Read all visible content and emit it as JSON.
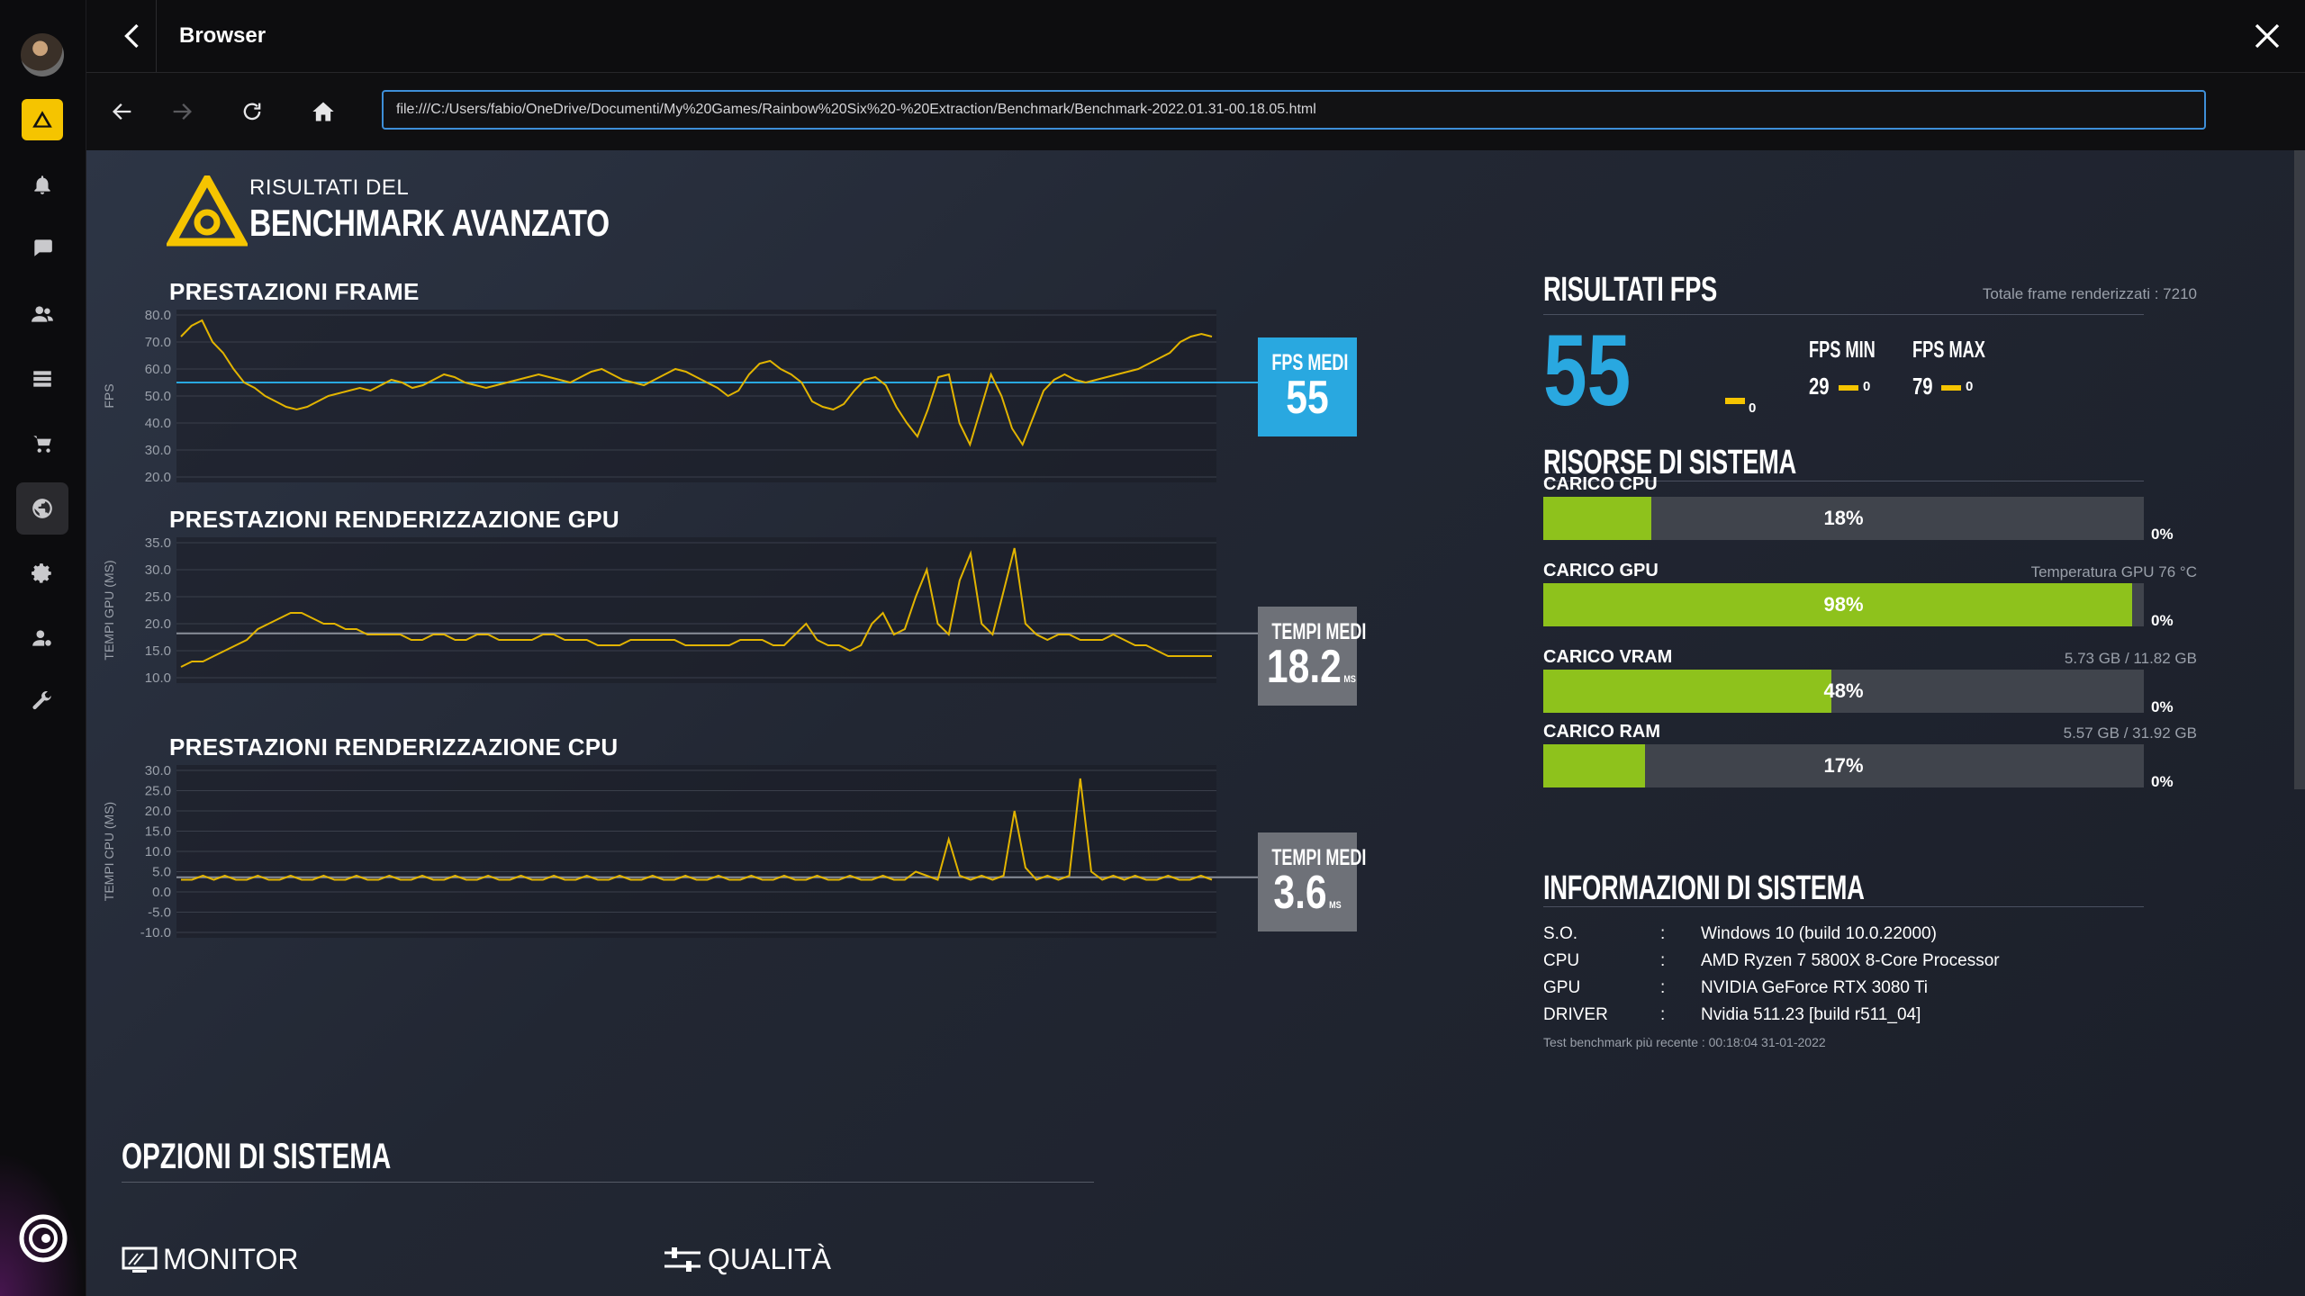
{
  "window": {
    "title": "Browser"
  },
  "browser": {
    "url": "file:///C:/Users/fabio/OneDrive/Documenti/My%20Games/Rainbow%20Six%20-%20Extraction/Benchmark/Benchmark-2022.01.31-00.18.05.html"
  },
  "sidebar": {
    "items": [
      "avatar",
      "benchmark",
      "notifications",
      "chat",
      "friends",
      "library",
      "store",
      "world",
      "settings",
      "account",
      "tools"
    ]
  },
  "colors": {
    "accent": "#f5c400",
    "fps_blue": "#29a8e0",
    "bar_green": "#8ec21c",
    "line_yellow": "#e2b400"
  },
  "hero": {
    "small": "RISULTATI DEL",
    "big": "BENCHMARK AVANZATO"
  },
  "sections": {
    "frame": {
      "title": "PRESTAZIONI FRAME",
      "badge_label": "FPS MEDI",
      "badge_value": "55"
    },
    "gpu": {
      "title": "PRESTAZIONI RENDERIZZAZIONE GPU",
      "badge_label": "TEMPI MEDI",
      "badge_value": "18.2",
      "badge_unit": "MS"
    },
    "cpu": {
      "title": "PRESTAZIONI RENDERIZZAZIONE CPU",
      "badge_label": "TEMPI MEDI",
      "badge_value": "3.6",
      "badge_unit": "MS"
    }
  },
  "chart_data": [
    {
      "type": "line",
      "ylabel": "FPS",
      "yticks": [
        "80.0",
        "70.0",
        "60.0",
        "50.0",
        "40.0",
        "30.0",
        "20.0"
      ],
      "ylim": [
        20,
        80
      ],
      "avg": 55,
      "values": [
        72,
        76,
        78,
        70,
        66,
        60,
        55,
        53,
        50,
        48,
        46,
        45,
        46,
        48,
        50,
        51,
        52,
        53,
        52,
        54,
        56,
        55,
        53,
        54,
        56,
        58,
        57,
        55,
        54,
        53,
        54,
        55,
        56,
        57,
        58,
        57,
        56,
        55,
        57,
        59,
        60,
        58,
        56,
        55,
        54,
        56,
        58,
        60,
        59,
        57,
        55,
        53,
        50,
        52,
        58,
        62,
        63,
        60,
        58,
        55,
        48,
        46,
        45,
        47,
        52,
        56,
        57,
        54,
        46,
        40,
        35,
        45,
        57,
        58,
        40,
        32,
        45,
        58,
        50,
        38,
        32,
        42,
        52,
        56,
        58,
        56,
        55,
        56,
        57,
        58,
        59,
        60,
        62,
        64,
        66,
        70,
        72,
        73,
        72
      ]
    },
    {
      "type": "line",
      "ylabel": "TEMPI GPU (MS)",
      "yticks": [
        "35.0",
        "30.0",
        "25.0",
        "20.0",
        "15.0",
        "10.0"
      ],
      "ylim": [
        10,
        35
      ],
      "avg": 18.2,
      "values": [
        12,
        13,
        13,
        14,
        15,
        16,
        17,
        19,
        20,
        21,
        22,
        22,
        21,
        20,
        20,
        19,
        19,
        18,
        18,
        18,
        18,
        17,
        17,
        18,
        18,
        17,
        17,
        18,
        18,
        17,
        17,
        17,
        17,
        18,
        18,
        17,
        17,
        17,
        16,
        16,
        16,
        17,
        17,
        17,
        17,
        17,
        16,
        16,
        16,
        16,
        16,
        17,
        17,
        17,
        16,
        16,
        18,
        20,
        17,
        16,
        16,
        15,
        16,
        20,
        22,
        18,
        19,
        25,
        30,
        20,
        18,
        28,
        33,
        20,
        18,
        26,
        34,
        20,
        18,
        17,
        18,
        18,
        17,
        17,
        17,
        18,
        17,
        16,
        16,
        15,
        14,
        14,
        14,
        14,
        14
      ]
    },
    {
      "type": "line",
      "ylabel": "TEMPI CPU (MS)",
      "yticks": [
        "30.0",
        "25.0",
        "20.0",
        "15.0",
        "10.0",
        "5.0",
        "0.0",
        "-5.0",
        "-10.0"
      ],
      "ylim": [
        -10,
        30
      ],
      "avg": 3.6,
      "values": [
        3,
        3,
        4,
        3,
        4,
        3,
        3,
        4,
        3,
        3,
        4,
        3,
        3,
        4,
        3,
        3,
        4,
        3,
        3,
        4,
        3,
        3,
        4,
        3,
        3,
        4,
        3,
        3,
        4,
        3,
        3,
        4,
        3,
        3,
        4,
        3,
        3,
        4,
        3,
        3,
        4,
        3,
        3,
        4,
        3,
        3,
        4,
        3,
        3,
        4,
        3,
        3,
        4,
        3,
        3,
        4,
        3,
        3,
        4,
        3,
        3,
        4,
        3,
        3,
        4,
        3,
        3,
        5,
        4,
        3,
        13,
        4,
        3,
        4,
        3,
        4,
        20,
        6,
        3,
        4,
        3,
        4,
        28,
        5,
        3,
        4,
        3,
        4,
        3,
        3,
        4,
        3,
        3,
        4,
        3
      ]
    }
  ],
  "fps": {
    "title": "RISULTATI FPS",
    "total_frames": "Totale frame renderizzati : 7210",
    "avg": "55",
    "avg_sub": "0",
    "min_label": "FPS MIN",
    "min": "29",
    "min_sub": "0",
    "max_label": "FPS MAX",
    "max": "79",
    "max_sub": "0"
  },
  "resources": {
    "title": "RISORSE DI SISTEMA",
    "items": [
      {
        "label": "CARICO CPU",
        "side": "",
        "value": "18%",
        "fraction": 0.18,
        "zero": "0%"
      },
      {
        "label": "CARICO GPU",
        "side": "Temperatura GPU 76 °C",
        "value": "98%",
        "fraction": 0.98,
        "zero": "0%"
      },
      {
        "label": "CARICO VRAM",
        "side": "5.73 GB / 11.82 GB",
        "value": "48%",
        "fraction": 0.48,
        "zero": "0%"
      },
      {
        "label": "CARICO RAM",
        "side": "5.57 GB / 31.92 GB",
        "value": "17%",
        "fraction": 0.17,
        "zero": "0%"
      }
    ]
  },
  "sysinfo": {
    "title": "INFORMAZIONI DI SISTEMA",
    "rows": [
      {
        "key": "S.O.",
        "colon": ":",
        "value": "Windows 10 (build 10.0.22000)"
      },
      {
        "key": "CPU",
        "colon": ":",
        "value": "AMD Ryzen 7 5800X 8-Core Processor"
      },
      {
        "key": "GPU",
        "colon": ":",
        "value": "NVIDIA GeForce RTX 3080 Ti"
      },
      {
        "key": "DRIVER",
        "colon": ":",
        "value": "Nvidia 511.23 [build r511_04]"
      }
    ],
    "footer": "Test benchmark più recente : 00:18:04 31-01-2022"
  },
  "options": {
    "title": "OPZIONI DI SISTEMA",
    "monitor": "MONITOR",
    "quality": "QUALITÀ"
  }
}
